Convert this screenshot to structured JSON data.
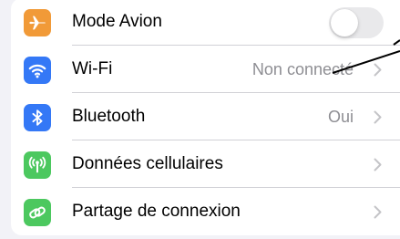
{
  "settings": {
    "rows": [
      {
        "icon": "airplane-icon",
        "icon_color": "#f19a38",
        "label": "Mode Avion",
        "control": "toggle",
        "toggle_on": false
      },
      {
        "icon": "wifi-icon",
        "icon_color": "#3478f6",
        "label": "Wi-Fi",
        "value": "Non connecté"
      },
      {
        "icon": "bluetooth-icon",
        "icon_color": "#3478f6",
        "label": "Bluetooth",
        "value": "Oui"
      },
      {
        "icon": "cellular-antenna-icon",
        "icon_color": "#4cc85f",
        "label": "Données cellulaires"
      },
      {
        "icon": "personal-hotspot-icon",
        "icon_color": "#4cc85f",
        "label": "Partage de connexion"
      }
    ]
  },
  "colors": {
    "background": "#f2f2f7",
    "group_background": "#ffffff",
    "secondary_text": "#8e8e93",
    "separator": "#d1d1d6",
    "annotation_line": "#000000"
  }
}
